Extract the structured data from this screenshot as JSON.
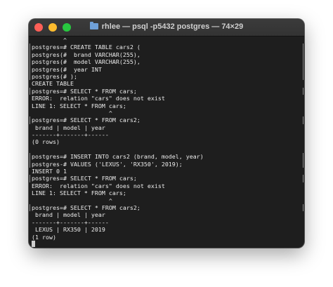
{
  "window": {
    "title": "rhlee — psql -p5432 postgres — 74×29"
  },
  "terminal": {
    "lines": [
      "         ^",
      "postgres=# CREATE TABLE cars2 (",
      "postgres(#  brand VARCHAR(255),",
      "postgres(#  model VARCHAR(255),",
      "postgres(#  year INT",
      "postgres(# );",
      "CREATE TABLE",
      "postgres=# SELECT * FROM cars;",
      "ERROR:  relation \"cars\" does not exist",
      "LINE 1: SELECT * FROM cars;",
      "                      ^",
      "postgres=# SELECT * FROM cars2;",
      " brand | model | year",
      "-------+-------+------",
      "(0 rows)",
      "",
      "postgres=# INSERT INTO cars2 (brand, model, year)",
      "postgres-# VALUES ('LEXUS', 'RX350', 2019);",
      "INSERT 0 1",
      "postgres=# SELECT * FROM cars;",
      "ERROR:  relation \"cars\" does not exist",
      "LINE 1: SELECT * FROM cars;",
      "                      ^",
      "postgres=# SELECT * FROM cars2;",
      " brand | model | year",
      "-------+-------+------",
      " LEXUS | RX350 | 2019",
      "(1 row)",
      ""
    ],
    "bracketed_lines": [
      1,
      2,
      3,
      4,
      5,
      7,
      11,
      16,
      17,
      19,
      23
    ]
  }
}
